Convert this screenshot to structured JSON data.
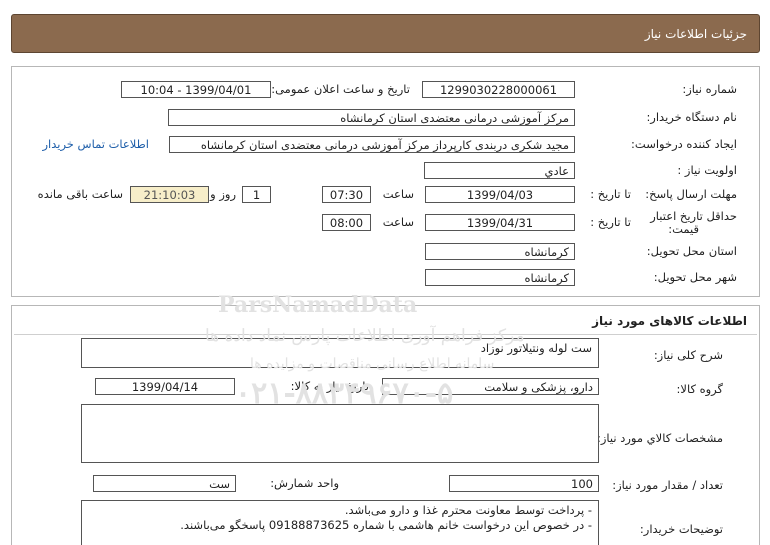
{
  "header": {
    "title": "جزئیات اطلاعات نیاز"
  },
  "need_info": {
    "need_number_label": "شماره نیاز:",
    "need_number": "1299030228000061",
    "announce_label": "تاریخ و ساعت اعلان عمومی:",
    "announce_value": "1399/04/01 - 10:04",
    "buyer_org_label": "نام دستگاه خریدار:",
    "buyer_org": "مرکز آموزشی درمانی معتضدی استان کرمانشاه",
    "requester_label": "ایجاد کننده درخواست:",
    "requester": "مجید شکری دربندی کارپرداز مرکز آموزشی درمانی معتضدی استان کرمانشاه",
    "contact_link": "اطلاعات تماس خریدار",
    "priority_label": "اولویت نیاز :",
    "priority": "عادي",
    "deadline_label": "مهلت ارسال پاسخ:",
    "to_date_label": "تا تاریخ :",
    "deadline_date": "1399/04/03",
    "time_label": "ساعت",
    "deadline_time": "07:30",
    "days_value": "1",
    "days_label": "روز و",
    "remaining_time": "21:10:03",
    "remaining_label": "ساعت باقی مانده",
    "validity_label_1": "حداقل تاریخ اعتبار",
    "validity_label_2": "قیمت:",
    "validity_date": "1399/04/31",
    "validity_time": "08:00",
    "province_label": "استان محل تحویل:",
    "province": "کرمانشاه",
    "city_label": "شهر محل تحویل:",
    "city": "کرمانشاه"
  },
  "goods": {
    "section_title": "اطلاعات کالاهای مورد نیاز",
    "desc_label": "شرح کلی نیاز:",
    "desc": "ست لوله ونتیلاتور نوزاد",
    "group_label": "گروه کالا:",
    "group": "دارو، پزشکی و سلامت",
    "need_date_label": "تاریخ نیاز به کالا:",
    "need_date": "1399/04/14",
    "spec_label": "مشخصات کالاي مورد نیاز:",
    "spec": "",
    "qty_label": "تعداد / مقدار مورد نیاز:",
    "qty": "100",
    "unit_label": "واحد شمارش:",
    "unit": "ست",
    "buyer_notes_label": "توضیحات خریدار:",
    "buyer_notes_1": "- پرداخت توسط معاونت محترم غذا و دارو می‌باشد.",
    "buyer_notes_2": "- در خصوص این درخواست خانم هاشمی با شماره 09188873625 پاسخگو می‌باشند."
  },
  "watermark": {
    "brand": "ParsNamadData",
    "line_1": "مرکز فراهم آوری اطلاعات پارس نماد داده ها",
    "line_2": "سامانه اطلاع رسانی مناقصات و مزایده ها",
    "phone": "۰۲۱-۸۸۳۴۹۶۷۰-۵"
  }
}
